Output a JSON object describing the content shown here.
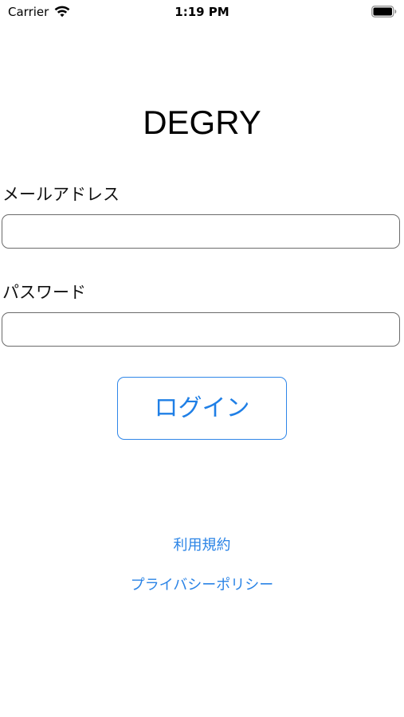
{
  "status_bar": {
    "carrier": "Carrier",
    "time": "1:19 PM",
    "wifi_icon": "wifi-icon",
    "battery_icon": "battery-icon"
  },
  "app": {
    "title": "DEGRY"
  },
  "form": {
    "email_label": "メールアドレス",
    "email_value": "",
    "password_label": "パスワード",
    "password_value": "",
    "login_button": "ログイン"
  },
  "links": {
    "terms": "利用規約",
    "privacy": "プライバシーポリシー"
  },
  "colors": {
    "accent": "#1f7fe6",
    "field_border": "#6b6b6b",
    "background": "#ffffff"
  }
}
